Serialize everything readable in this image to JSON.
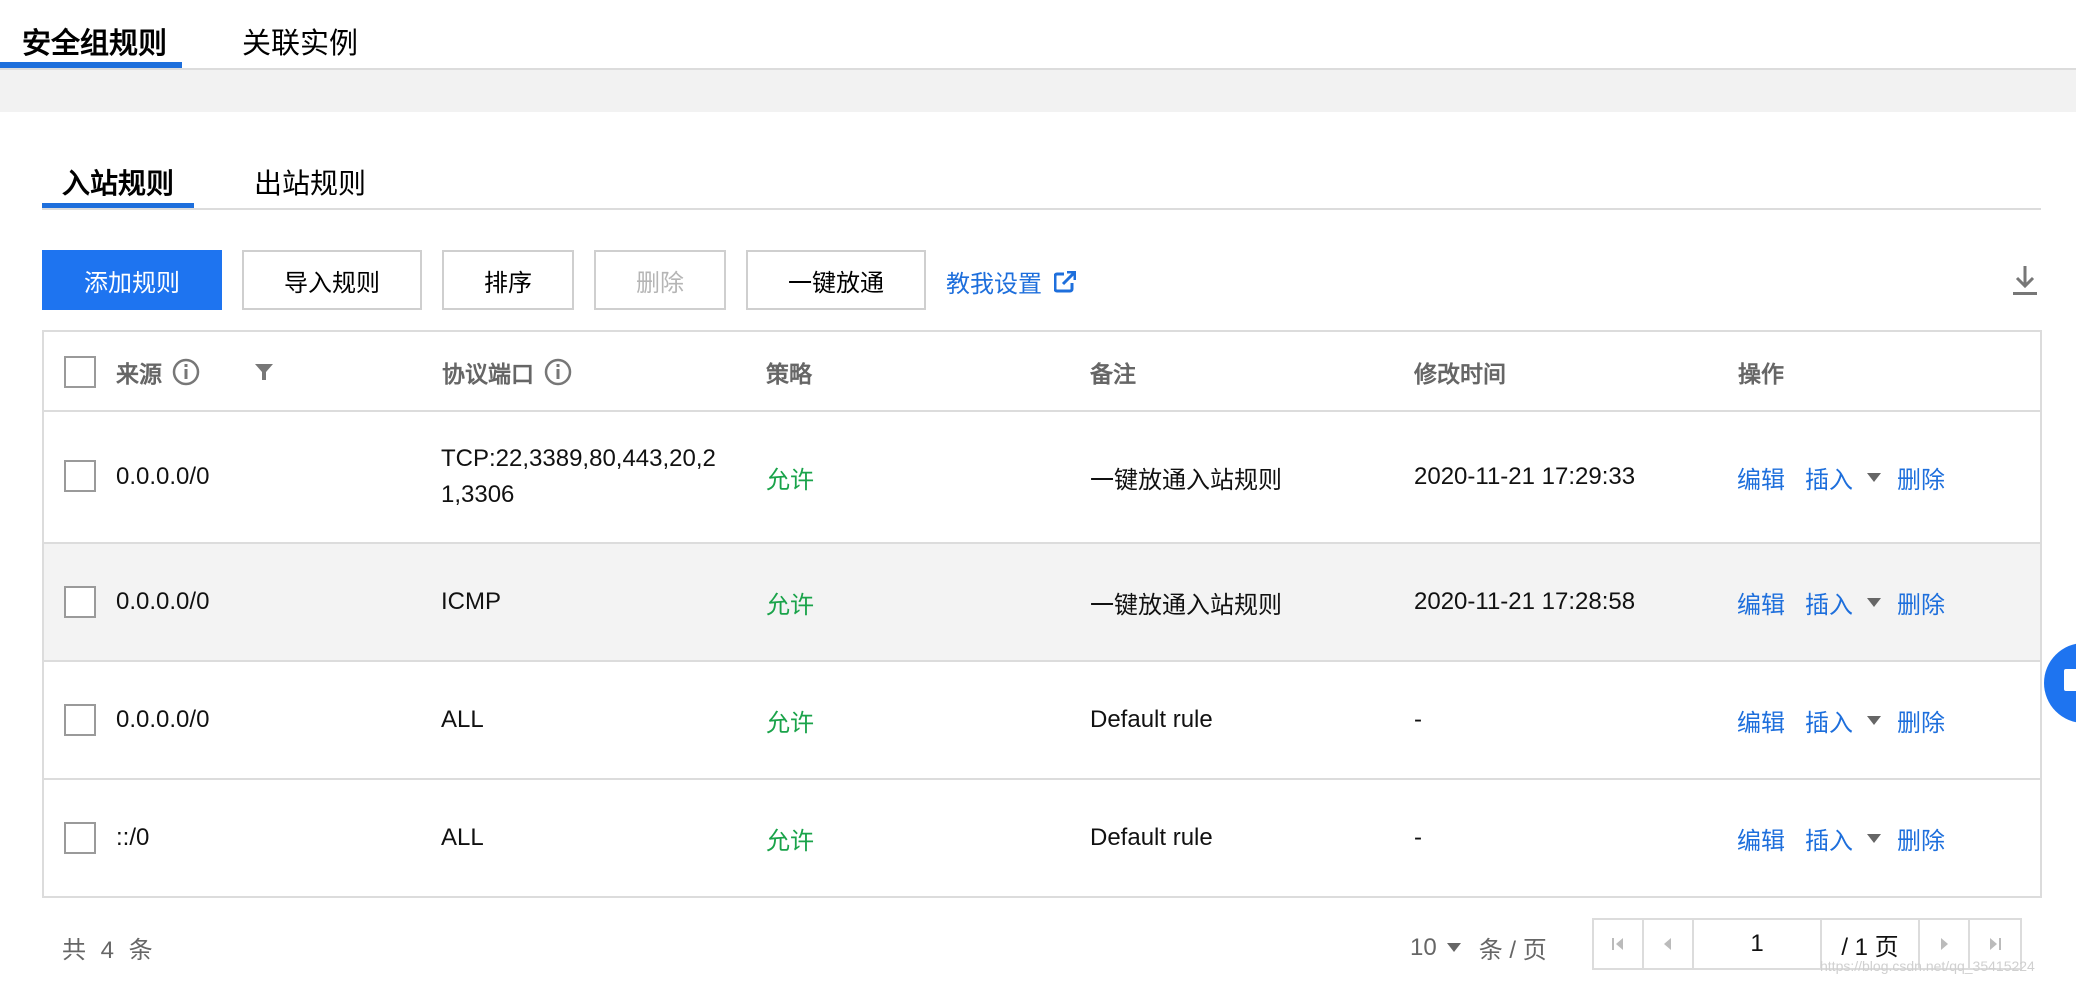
{
  "top_tabs": [
    {
      "label": "安全组规则",
      "active": true
    },
    {
      "label": "关联实例",
      "active": false
    }
  ],
  "sub_tabs": [
    {
      "label": "入站规则",
      "active": true
    },
    {
      "label": "出站规则",
      "active": false
    }
  ],
  "toolbar": {
    "add_label": "添加规则",
    "import_label": "导入规则",
    "sort_label": "排序",
    "delete_label": "删除",
    "open_all_label": "一键放通",
    "help_link": "教我设置"
  },
  "table": {
    "headers": {
      "source": "来源",
      "protocol_port": "协议端口",
      "policy": "策略",
      "remark": "备注",
      "modified": "修改时间",
      "actions": "操作"
    },
    "rows": [
      {
        "source": "0.0.0.0/0",
        "protocol_port": "TCP:22,3389,80,443,20,21,3306",
        "policy": "允许",
        "remark": "一键放通入站规则",
        "modified": "2020-11-21 17:29:33"
      },
      {
        "source": "0.0.0.0/0",
        "protocol_port": "ICMP",
        "policy": "允许",
        "remark": "一键放通入站规则",
        "modified": "2020-11-21 17:28:58"
      },
      {
        "source": "0.0.0.0/0",
        "protocol_port": "ALL",
        "policy": "允许",
        "remark": "Default rule",
        "modified": "-"
      },
      {
        "source": "::/0",
        "protocol_port": "ALL",
        "policy": "允许",
        "remark": "Default rule",
        "modified": "-"
      }
    ],
    "row_actions": {
      "edit": "编辑",
      "insert": "插入",
      "delete": "删除"
    }
  },
  "footer": {
    "total": "共 4 条",
    "page_size": "10",
    "page_size_unit": "条 / 页",
    "current_page": "1",
    "total_pages": "/ 1 页"
  },
  "watermark": "https://blog.csdn.net/qq_35415224",
  "colors": {
    "accent": "#1e74f0",
    "allow": "#1aa34a",
    "link": "#1e6fdc"
  }
}
